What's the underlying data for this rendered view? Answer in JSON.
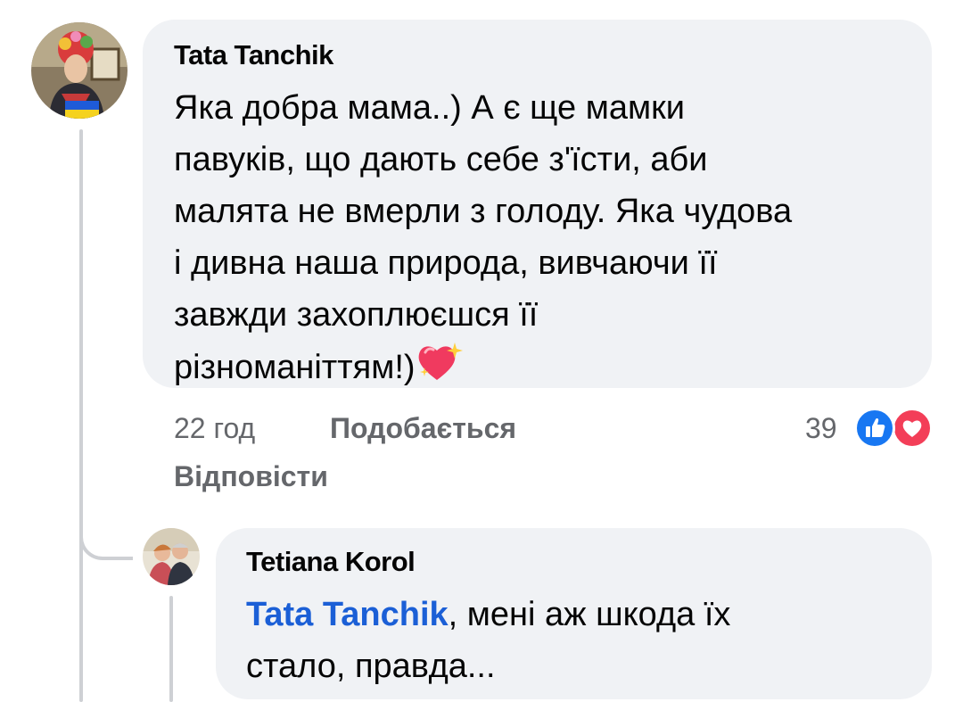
{
  "comment": {
    "author": "Tata Tanchik",
    "lines": [
      "Яка добра мама..) А є ще мамки",
      "павуків, що дають себе з'їсти, аби",
      "малята не вмерли з голоду. Яка чудова",
      "і дивна наша природа, вивчаючи її",
      "завжди захоплюєшся її",
      "різноманіттям!)"
    ],
    "emoji_icon": "sparkling-heart-icon",
    "time": "22 год",
    "like_label": "Подобається",
    "reply_label": "Відповісти",
    "reaction_count": "39",
    "reaction_icons": [
      "like-icon",
      "love-icon"
    ]
  },
  "reply": {
    "author": "Tetiana Korol",
    "mention": "Tata Tanchik",
    "text_after_mention": ", мені аж шкода їх",
    "line2": "стало, правда..."
  },
  "colors": {
    "bubble": "#f0f2f5",
    "meta": "#65676b",
    "mention": "#1b5fd6",
    "like_blue": "#1877f2",
    "love_red": "#f33e58"
  }
}
